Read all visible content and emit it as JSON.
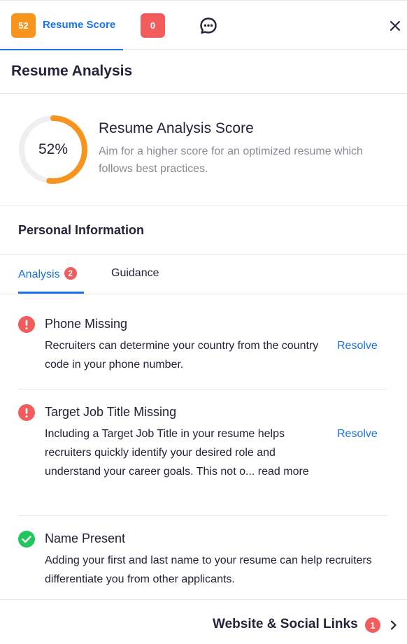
{
  "tabs": {
    "score_badge": "52",
    "score_label": "Resume Score",
    "errors_badge": "0"
  },
  "icons": {
    "chat": "chat-bubble-icon",
    "close": "close-icon",
    "error": "exclamation-circle-icon",
    "success": "check-circle-icon",
    "chevron": "chevron-right-icon"
  },
  "header": {
    "title": "Resume Analysis"
  },
  "score_card": {
    "percent_label": "52%",
    "percent_value": 0.52,
    "title": "Resume Analysis Score",
    "description": "Aim for a higher score for an optimized resume which follows best practices."
  },
  "section": {
    "title": "Personal Information"
  },
  "subtabs": {
    "analysis_label": "Analysis",
    "analysis_count": "2",
    "guidance_label": "Guidance"
  },
  "items": [
    {
      "status": "error",
      "title": "Phone Missing",
      "body": "Recruiters can determine your country from the country code in your phone number.",
      "action": "Resolve"
    },
    {
      "status": "error",
      "title": "Target Job Title Missing",
      "body": "Including a Target Job Title in your resume helps recruiters quickly identify your desired role and understand your career goals. This not o... read more",
      "action": "Resolve"
    },
    {
      "status": "success",
      "title": "Name Present",
      "body": "Adding your first and last name to your resume can help recruiters differentiate you from other applicants."
    }
  ],
  "footer": {
    "label": "Website & Social Links",
    "count": "1"
  },
  "colors": {
    "accent": "#1a73e8",
    "score_orange": "#f7941d",
    "error_red": "#f25c5c",
    "success_green": "#22c55e"
  }
}
